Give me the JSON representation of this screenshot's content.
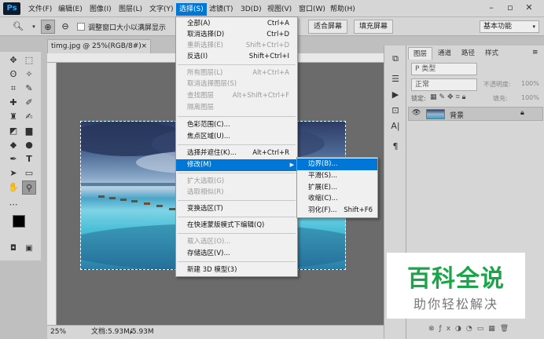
{
  "app": {
    "logo": "Ps",
    "menus": [
      "文件(F)",
      "编辑(E)",
      "图像(I)",
      "图层(L)",
      "文字(Y)",
      "选择(S)",
      "滤镜(T)",
      "3D(D)",
      "视图(V)",
      "窗口(W)",
      "帮助(H)"
    ],
    "active_menu": "选择(S)"
  },
  "options_bar": {
    "resize_windows_label": "调整窗口大小以满屏显示",
    "fit_screen": "适合屏幕",
    "fill_screen": "填充屏幕",
    "workspace": "基本功能"
  },
  "document": {
    "tab_title": "timg.jpg @ 25%(RGB/8#)",
    "zoom": "25%",
    "doc_info": "文档:5.93M/5.93M"
  },
  "select_menu": {
    "items": [
      {
        "label": "全部(A)",
        "shortcut": "Ctrl+A",
        "disabled": false
      },
      {
        "label": "取消选择(D)",
        "shortcut": "Ctrl+D",
        "disabled": false
      },
      {
        "label": "重新选择(E)",
        "shortcut": "Shift+Ctrl+D",
        "disabled": true
      },
      {
        "label": "反选(I)",
        "shortcut": "Shift+Ctrl+I",
        "disabled": false
      },
      {
        "label": "所有图层(L)",
        "shortcut": "Alt+Ctrl+A",
        "disabled": true
      },
      {
        "label": "取消选择图层(S)",
        "shortcut": "",
        "disabled": true
      },
      {
        "label": "查找图层",
        "shortcut": "Alt+Shift+Ctrl+F",
        "disabled": true
      },
      {
        "label": "隔离图层",
        "shortcut": "",
        "disabled": true
      },
      {
        "label": "色彩范围(C)...",
        "shortcut": "",
        "disabled": false
      },
      {
        "label": "焦点区域(U)...",
        "shortcut": "",
        "disabled": false
      },
      {
        "label": "选择并遮住(K)...",
        "shortcut": "Alt+Ctrl+R",
        "disabled": false
      },
      {
        "label": "修改(M)",
        "shortcut": "",
        "disabled": false,
        "submenu": true
      },
      {
        "label": "扩大选取(G)",
        "shortcut": "",
        "disabled": true
      },
      {
        "label": "选取相似(R)",
        "shortcut": "",
        "disabled": true
      },
      {
        "label": "变换选区(T)",
        "shortcut": "",
        "disabled": false
      },
      {
        "label": "在快速蒙版模式下编辑(Q)",
        "shortcut": "",
        "disabled": false
      },
      {
        "label": "载入选区(O)...",
        "shortcut": "",
        "disabled": true
      },
      {
        "label": "存储选区(V)...",
        "shortcut": "",
        "disabled": false
      },
      {
        "label": "新建 3D 模型(3)",
        "shortcut": "",
        "disabled": false
      }
    ]
  },
  "modify_submenu": {
    "items": [
      {
        "label": "边界(B)...",
        "shortcut": ""
      },
      {
        "label": "平滑(S)...",
        "shortcut": ""
      },
      {
        "label": "扩展(E)...",
        "shortcut": ""
      },
      {
        "label": "收缩(C)...",
        "shortcut": ""
      },
      {
        "label": "羽化(F)...",
        "shortcut": "Shift+F6"
      }
    ]
  },
  "layers_panel": {
    "tabs": [
      "图层",
      "通道",
      "路径",
      "样式"
    ],
    "filter_type": "P 类型",
    "blend_mode": "正常",
    "opacity_label": "不透明度:",
    "opacity_value": "100%",
    "lock_label": "锁定:",
    "fill_label": "填充:",
    "fill_value": "100%",
    "layer_name": "背景"
  },
  "watermark": {
    "title": "百科全说",
    "subtitle": "助你轻松解决"
  },
  "colors": {
    "menu_highlight": "#0077d7",
    "watermark_green": "#1aa548"
  }
}
